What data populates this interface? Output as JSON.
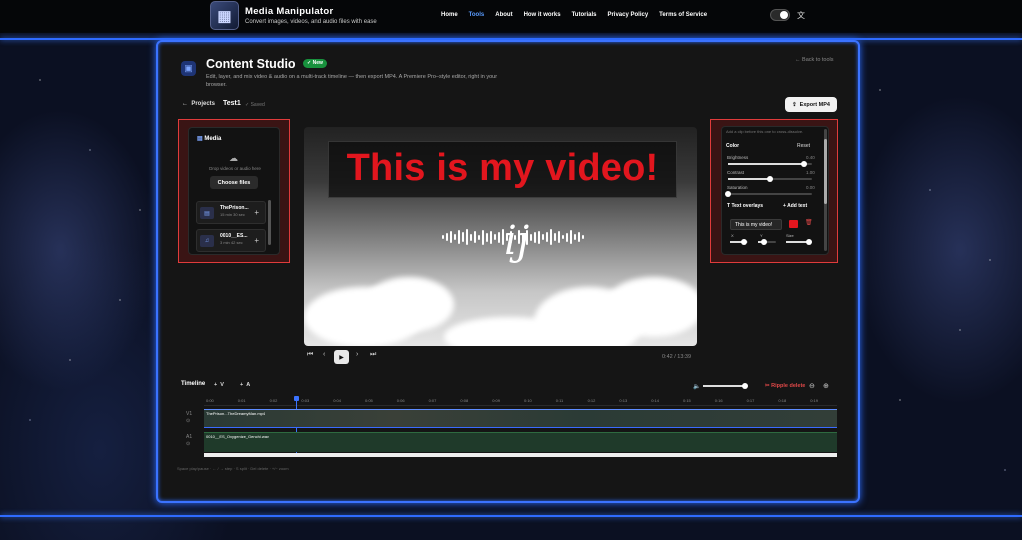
{
  "brand": {
    "title": "Media Manipulator",
    "subtitle": "Convert images, videos, and audio files with ease"
  },
  "nav": [
    {
      "label": "Home",
      "active": false
    },
    {
      "label": "Tools",
      "active": true
    },
    {
      "label": "About",
      "active": false
    },
    {
      "label": "How it works",
      "active": false
    },
    {
      "label": "Tutorials",
      "active": false
    },
    {
      "label": "Privacy Policy",
      "active": false
    },
    {
      "label": "Terms of Service",
      "active": false
    }
  ],
  "header": {
    "title": "Content Studio",
    "badge": "New",
    "description": "Edit, layer, and mix video & audio on a multi-track timeline — then export MP4. A Premiere Pro–style editor, right in your browser.",
    "back": "Back to tools"
  },
  "project": {
    "projects_label": "Projects",
    "name": "Test1",
    "status": "Saved",
    "export_label": "Export MP4"
  },
  "media": {
    "title": "Media",
    "drop_hint": "Drop videos or audio here",
    "choose_label": "Choose files",
    "items": [
      {
        "name": "ThePrison...",
        "meta": "15 min 30 sec"
      },
      {
        "name": "0010__ES...",
        "meta": "3 min 42 sec"
      }
    ]
  },
  "preview": {
    "overlay_text": "This is my video!",
    "time": "0:42 / 13:39"
  },
  "properties": {
    "hint": "Add a clip before this one to cross-dissolve.",
    "color_label": "Color",
    "reset_label": "Reset",
    "brightness": {
      "label": "Brightness",
      "value": "0.40",
      "level": 0.9
    },
    "contrast": {
      "label": "Contrast",
      "value": "1.00",
      "level": 0.5
    },
    "saturation": {
      "label": "Saturation",
      "value": "0.00",
      "level": 0.0
    },
    "overlays_label": "Text overlays",
    "add_text_label": "Add text",
    "overlay_value": "This is my video!",
    "overlay_color": "#e2161e",
    "x_label": "X",
    "y_label": "Y",
    "size_label": "Size"
  },
  "timeline": {
    "title": "Timeline",
    "add_video": "V",
    "add_audio": "A",
    "ripple_label": "Ripple delete",
    "ticks": [
      "0:00",
      "0:01",
      "0:02",
      "0:03",
      "0:04",
      "0:05",
      "0:06",
      "0:07",
      "0:08",
      "0:09",
      "0:10",
      "0:11",
      "0:12",
      "0:13",
      "0:14",
      "0:15",
      "0:16",
      "0:17",
      "0:18",
      "0:19"
    ],
    "video_track": {
      "name": "V1",
      "sub": "⊙",
      "clip": "ThePrison...TheDreamyMan.mp4"
    },
    "audio_track": {
      "name": "A1",
      "sub": "⊙",
      "clip": "0010__ES_Oxygenize_Genchi.wav"
    },
    "shortcuts": "Space play/pause · ← / → step · S split · Del delete · +/− zoom"
  },
  "colors": {
    "accent": "#3b73ff",
    "danger": "#e03b3b",
    "badge": "#18913d"
  }
}
